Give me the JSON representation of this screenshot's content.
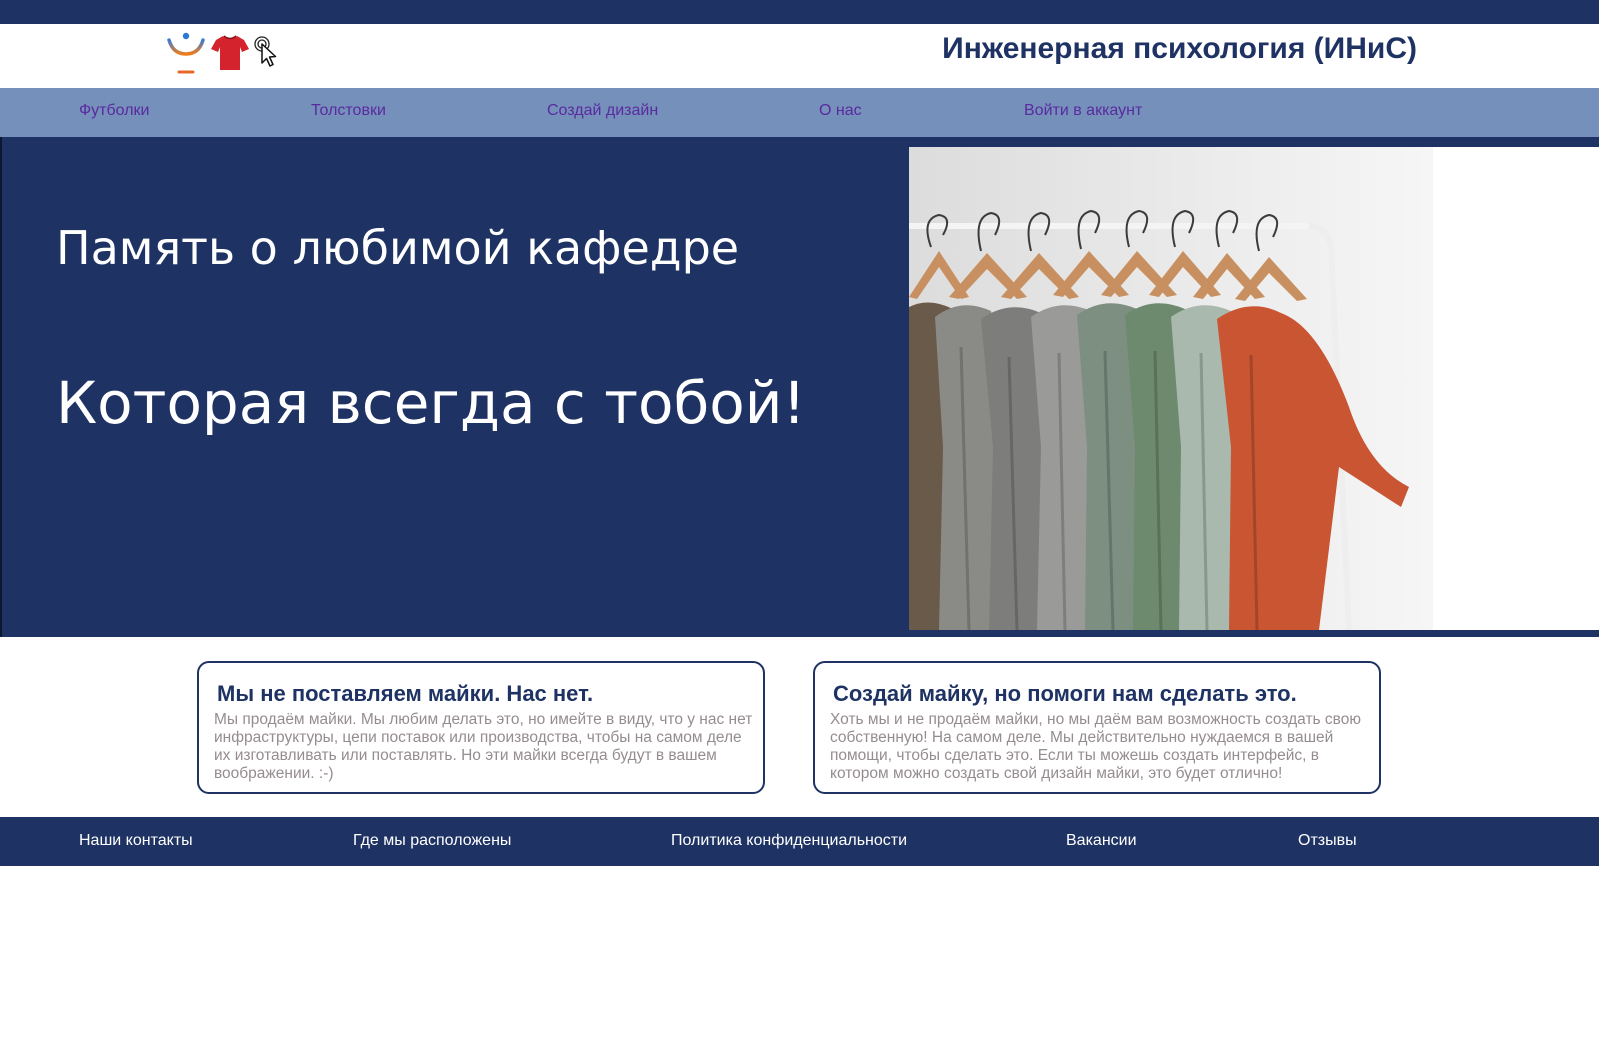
{
  "colors": {
    "brand_dark": "#1e3263",
    "nav_bg": "#7590ba",
    "nav_link": "#5a2aa0",
    "body_text": "#958c90"
  },
  "header": {
    "title": "Инженерная психология (ИНиС)",
    "icons": [
      "psi-logo-icon",
      "red-tshirt-icon",
      "pointer-cursor-icon"
    ]
  },
  "nav": {
    "items": [
      {
        "label": "Футболки"
      },
      {
        "label": "Толстовки"
      },
      {
        "label": "Создай дизайн"
      },
      {
        "label": "О нас"
      },
      {
        "label": "Войти в аккаунт"
      }
    ]
  },
  "hero": {
    "line1": "Память о любимой кафедре",
    "line2": "Которая всегда с тобой!"
  },
  "cards": [
    {
      "title": "Мы не поставляем майки. Нас нет.",
      "text": "Мы продаём майки. Мы любим делать это, но имейте в виду, что у нас нет инфраструктуры, цепи поставок или производства, чтобы на самом деле их изготавливать или поставлять. Но эти майки всегда будут в вашем воображении. :-)"
    },
    {
      "title": "Создай майку, но помоги нам сделать это.",
      "text": "Хоть мы и не продаём майки, но мы даём вам возможность создать свою собственную! На самом деле. Мы действительно нуждаемся в вашей помощи, чтобы сделать это. Если ты можешь создать интерфейс, в котором можно создать свой дизайн майки, это будет отлично!"
    }
  ],
  "footer": {
    "items": [
      {
        "label": "Наши контакты"
      },
      {
        "label": "Где мы расположены"
      },
      {
        "label": "Политика конфиденциальности"
      },
      {
        "label": "Вакансии"
      },
      {
        "label": "Отзывы"
      }
    ]
  }
}
